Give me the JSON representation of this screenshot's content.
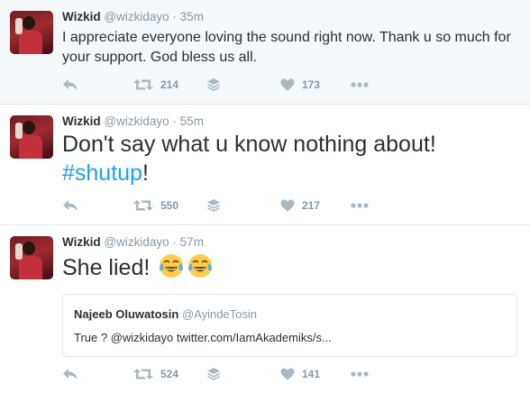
{
  "tweets": [
    {
      "author": {
        "name": "Wizkid",
        "handle": "@wizkidayo"
      },
      "separator": "·",
      "time": "35m",
      "text_line1": "I appreciate everyone loving the sound right now. Thank u so much for",
      "text_line2": "your support. God bless us all.",
      "retweets": "214",
      "likes": "173"
    },
    {
      "author": {
        "name": "Wizkid",
        "handle": "@wizkidayo"
      },
      "separator": "·",
      "time": "55m",
      "text_line1": "Don't say what u know nothing about!",
      "hashtag": "#shutup",
      "after_hashtag": "!",
      "retweets": "550",
      "likes": "217"
    },
    {
      "author": {
        "name": "Wizkid",
        "handle": "@wizkidayo"
      },
      "separator": "·",
      "time": "57m",
      "text": "She lied!",
      "emoji": [
        "face-with-tears-of-joy",
        "face-with-tears-of-joy"
      ],
      "quote": {
        "name": "Najeeb Oluwatosin",
        "handle": "@AyindeTosin",
        "text": "True ? @wizkidayo twitter.com/IamAkademiks/s..."
      },
      "retweets": "524",
      "likes": "141"
    }
  ],
  "icons": {
    "reply": "reply-icon",
    "retweet": "retweet-icon",
    "buffer": "layers-icon",
    "like": "heart-icon",
    "more": "more-dots-icon"
  },
  "colors": {
    "link": "#1da1f2",
    "muted": "#8899a6",
    "icon": "#aab8c2",
    "highlight_bg": "#f5f8fa"
  }
}
